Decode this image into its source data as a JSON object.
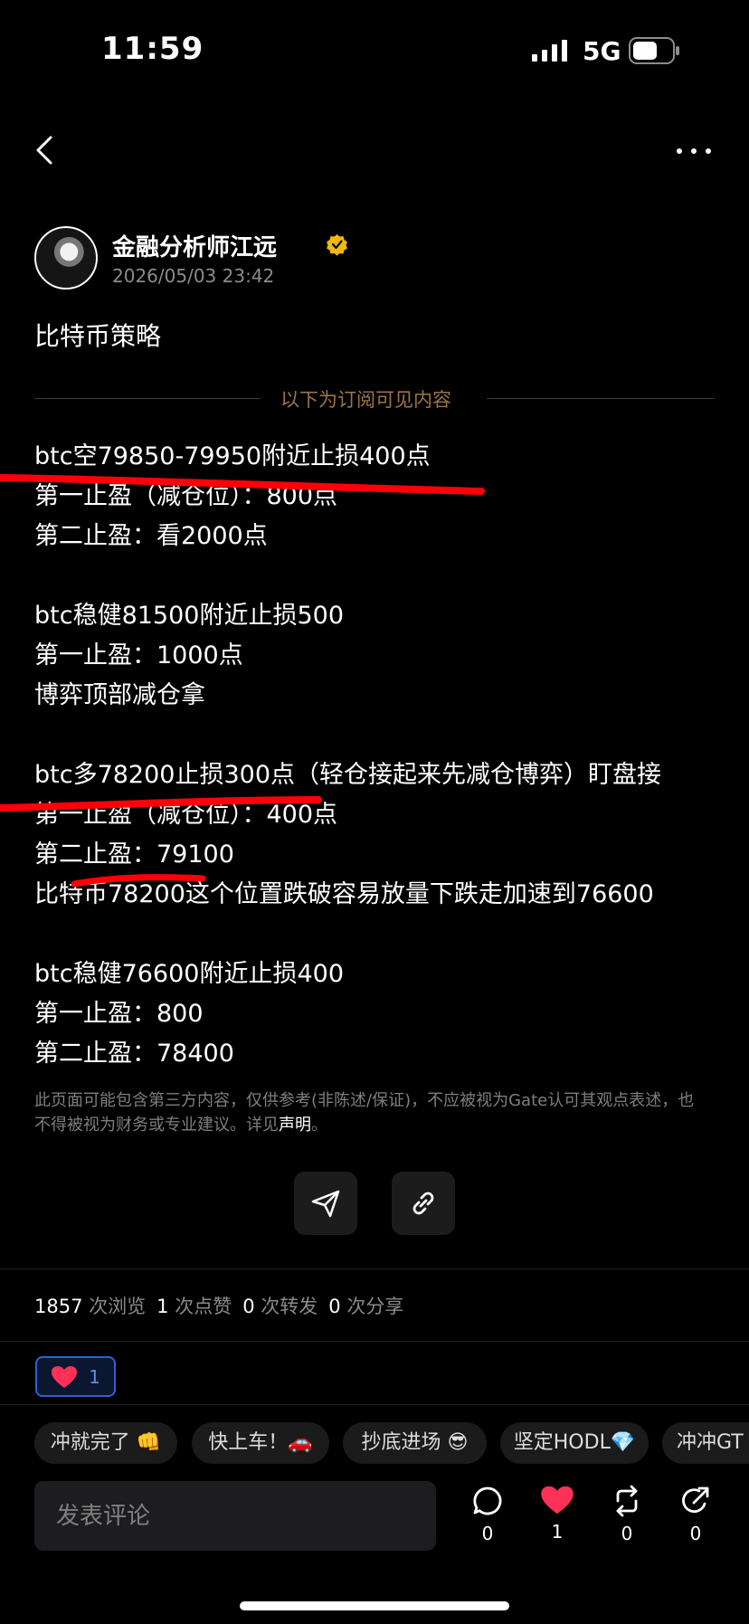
{
  "status_bar": {
    "time": "11:59",
    "network": "5G"
  },
  "author": {
    "name": "金融分析师江远",
    "date": "2026/05/03 23:42"
  },
  "post": {
    "title": "比特币策略",
    "divider_text": "以下为订阅可见内容",
    "lines": [
      "btc空79850-79950附近止损400点",
      "第一止盈（减仓位）：800点",
      "第二止盈：看2000点",
      "",
      "btc稳健81500附近止损500",
      "第一止盈：1000点",
      "博弈顶部减仓拿",
      "",
      "btc多78200止损300点（轻仓接起来先减仓博弈）盯盘接",
      "第一止盈（减仓位）：400点",
      "第二止盈：79100",
      "比特币78200这个位置跌破容易放量下跌走加速到76600",
      "",
      "btc稳健76600附近止损400",
      "第一止盈：800",
      "第二止盈：78400"
    ]
  },
  "disclaimer": {
    "text": "此页面可能包含第三方内容，仅供参考(非陈述/保证)，不应被视为Gate认可其观点表述，也不得被视为财务或专业建议。详见",
    "link": "声明",
    "end": "。"
  },
  "stats": {
    "views": "1857",
    "views_label": "次浏览",
    "likes": "1",
    "likes_label": "次点赞",
    "reposts": "0",
    "reposts_label": "次转发",
    "shares": "0",
    "shares_label": "次分享"
  },
  "reaction": {
    "icon": "heart-icon",
    "count": "1",
    "color": "#ff3157"
  },
  "chips": [
    "冲就完了 👊",
    "快上车！🚗",
    "抄底进场 😎",
    "坚定HODL💎",
    "冲冲GT"
  ],
  "comment": {
    "placeholder": "发表评论",
    "actions": [
      {
        "icon": "comment-icon",
        "count": "0"
      },
      {
        "icon": "heart-icon",
        "count": "1"
      },
      {
        "icon": "repost-icon",
        "count": "0"
      },
      {
        "icon": "share-icon",
        "count": "0"
      }
    ]
  },
  "colors": {
    "accent_divider": "#9b7448",
    "marker": "#ff0008",
    "reaction_border": "#2e61d0"
  }
}
